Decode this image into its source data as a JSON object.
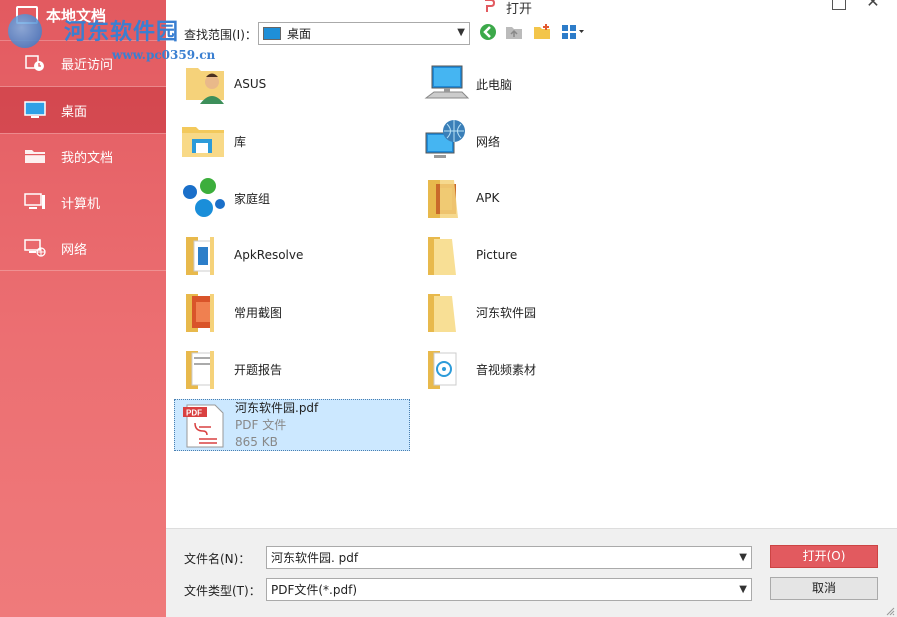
{
  "sidebar": {
    "title": "本地文档",
    "items": [
      {
        "label": "最近访问",
        "icon": "clock-icon"
      },
      {
        "label": "桌面",
        "icon": "desktop-icon",
        "active": true
      },
      {
        "label": "我的文档",
        "icon": "documents-folder-icon"
      },
      {
        "label": "计算机",
        "icon": "computer-icon"
      },
      {
        "label": "网络",
        "icon": "network-icon"
      }
    ]
  },
  "watermark": {
    "text": "河东软件园",
    "url": "www.pc0359.cn"
  },
  "window": {
    "title": "打开"
  },
  "toolbar": {
    "look_in_label": "查找范围(I)：",
    "look_in_value": "桌面"
  },
  "files": [
    {
      "name": "ASUS",
      "icon": "user-folder-icon"
    },
    {
      "name": "此电脑",
      "icon": "computer-icon"
    },
    {
      "name": "库",
      "icon": "library-icon"
    },
    {
      "name": "网络",
      "icon": "network-globe-icon"
    },
    {
      "name": "家庭组",
      "icon": "homegroup-icon"
    },
    {
      "name": "APK",
      "icon": "folder-icon"
    },
    {
      "name": "ApkResolve",
      "icon": "folder-icon"
    },
    {
      "name": "Picture",
      "icon": "folder-icon"
    },
    {
      "name": "常用截图",
      "icon": "folder-icon"
    },
    {
      "name": "河东软件园",
      "icon": "folder-icon"
    },
    {
      "name": "开题报告",
      "icon": "folder-icon"
    },
    {
      "name": "音视频素材",
      "icon": "folder-icon"
    },
    {
      "name": "河东软件园.pdf",
      "type": "PDF 文件",
      "size": "865 KB",
      "icon": "pdf-file-icon",
      "selected": true
    }
  ],
  "bottom": {
    "filename_label": "文件名(N)：",
    "filename_value": "河东软件园. pdf",
    "filetype_label": "文件类型(T)：",
    "filetype_value": "PDF文件(*.pdf)",
    "open_label": "打开(O)",
    "cancel_label": "取消"
  },
  "colors": {
    "accent": "#e25a5f",
    "selection": "#cce8ff"
  }
}
